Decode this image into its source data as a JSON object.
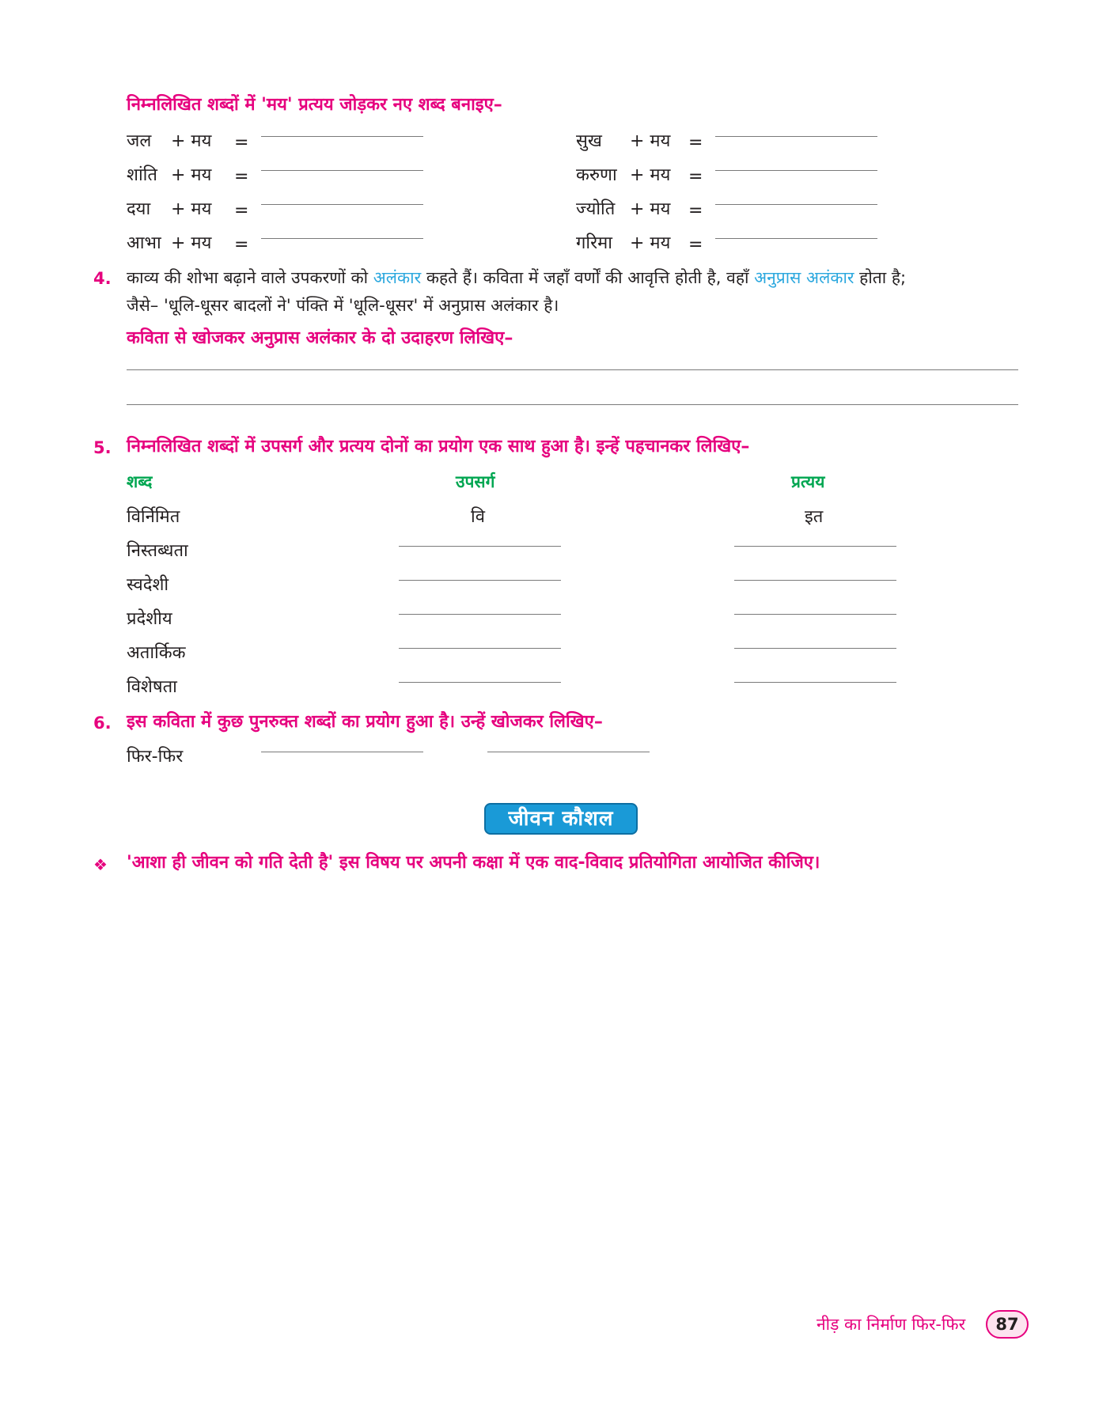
{
  "section_may": {
    "heading": "निम्नलिखित शब्दों में 'मय' प्रत्यय जोड़कर नए शब्द बनाइए–",
    "plus_suffix": "+ मय",
    "equals": "=",
    "left_words": [
      "जल",
      "शांति",
      "दया",
      "आभा"
    ],
    "right_words": [
      "सुख",
      "करुणा",
      "ज्योति",
      "गरिमा"
    ]
  },
  "q4": {
    "number": "4.",
    "line1_part1": "काव्य की शोभा बढ़ाने वाले उपकरणों को ",
    "line1_highlight1": "अलंकार",
    "line1_part2": " कहते हैं। कविता में जहाँ वर्णों की आवृत्ति होती है, वहाँ ",
    "line1_highlight2": "अनुप्रास अलंकार",
    "line1_part3": " होता है;",
    "line2": "जैसे– 'धूलि-धूसर बादलों ने' पंक्ति में 'धूलि-धूसर' में अनुप्रास अलंकार है।",
    "instruction": "कविता से खोजकर अनुप्रास अलंकार के दो उदाहरण लिखिए–"
  },
  "q5": {
    "number": "5.",
    "instruction": "निम्नलिखित शब्दों में उपसर्ग और प्रत्यय दोनों का प्रयोग एक साथ हुआ है। इन्हें पहचानकर लिखिए–",
    "headers": [
      "शब्द",
      "उपसर्ग",
      "प्रत्यय"
    ],
    "example_word": "विर्निमित",
    "example_prefix": "वि",
    "example_suffix": "इत",
    "words": [
      "निस्तब्धता",
      "स्वदेशी",
      "प्रदेशीय",
      "अतार्किक",
      "विशेषता"
    ]
  },
  "q6": {
    "number": "6.",
    "instruction": "इस कविता में कुछ पुनरुक्त शब्दों का प्रयोग हुआ है। उन्हें खोजकर लिखिए–",
    "example": "फिर-फिर"
  },
  "life_skill": {
    "badge": "जीवन कौशल",
    "bullet": "❖",
    "text": "'आशा ही जीवन को गति देती है' इस विषय पर अपनी कक्षा में एक वाद-विवाद प्रतियोगिता आयोजित कीजिए।"
  },
  "footer": {
    "chapter_title": "नीड़ का निर्माण फिर-फिर",
    "page_number": "87"
  },
  "colors": {
    "heading_pink": "#e6007e",
    "keyword_blue": "#2aa7de",
    "header_green": "#00a651",
    "badge_blue": "#1a9ad7"
  }
}
